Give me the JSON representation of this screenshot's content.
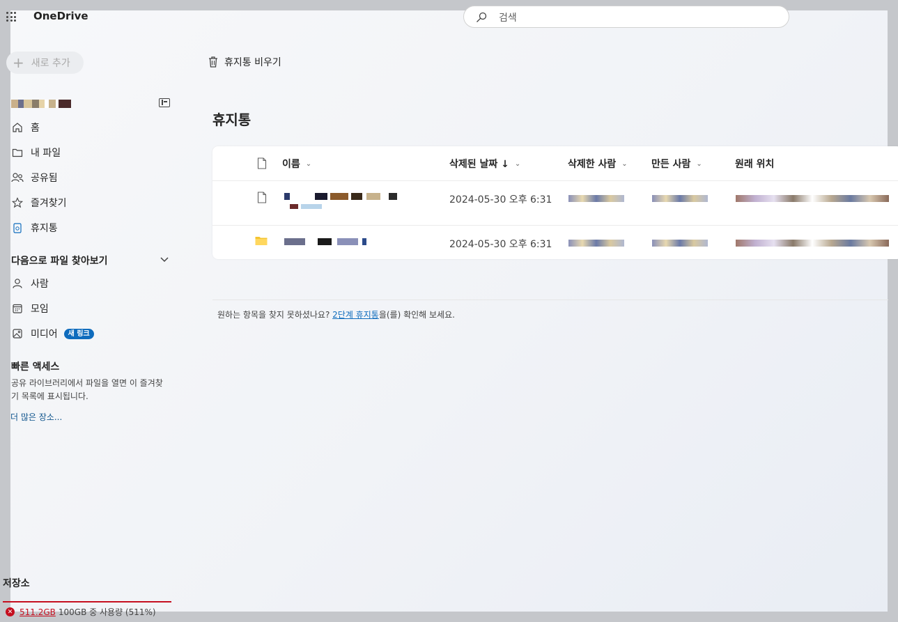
{
  "app": {
    "name": "OneDrive"
  },
  "search": {
    "placeholder": "검색"
  },
  "sidebar": {
    "new_label": "새로 추가",
    "nav": [
      {
        "label": "홈",
        "icon": "home-icon"
      },
      {
        "label": "내 파일",
        "icon": "folder-icon"
      },
      {
        "label": "공유됨",
        "icon": "people-icon"
      },
      {
        "label": "즐겨찾기",
        "icon": "star-icon"
      },
      {
        "label": "휴지통",
        "icon": "recycle-bin-icon"
      }
    ],
    "browse_heading": "다음으로 파일 찾아보기",
    "browse": [
      {
        "label": "사람",
        "icon": "person-icon"
      },
      {
        "label": "모임",
        "icon": "calendar-icon"
      },
      {
        "label": "미디어",
        "icon": "image-icon",
        "badge": "새 링크"
      }
    ],
    "quick_access_heading": "빠른 액세스",
    "quick_access_text": "공유 라이브러리에서 파일을 열면 이 즐겨찾기 목록에 표시됩니다.",
    "more_places": "더 많은 장소...",
    "storage_heading": "저장소",
    "storage_used": "511.2GB",
    "storage_detail": "100GB 중 사용량 (511%)"
  },
  "toolbar": {
    "empty_recycle": "휴지통 비우기"
  },
  "page": {
    "title": "휴지통"
  },
  "table": {
    "columns": {
      "name": "이름",
      "deleted_date": "삭제된 날짜 ↓",
      "deleted_by": "삭제한 사람",
      "created_by": "만든 사람",
      "original_location": "원래 위치"
    },
    "rows": [
      {
        "type": "file",
        "deleted_date": "2024-05-30 오후 6:31"
      },
      {
        "type": "folder",
        "deleted_date": "2024-05-30 오후 6:31"
      }
    ]
  },
  "hint": {
    "before": "원하는 항목을 찾지 못하셨나요? ",
    "link": "2단계 휴지통",
    "after": "을(를) 확인해 보세요."
  },
  "colors": {
    "accent": "#0f6cbd",
    "error": "#c50f1f",
    "folder": "#f4c430"
  }
}
